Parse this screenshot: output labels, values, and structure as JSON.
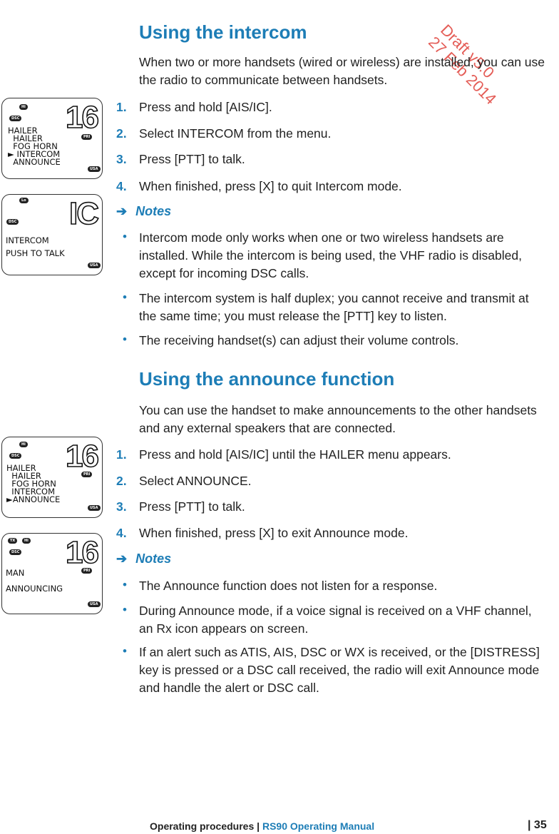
{
  "section1": {
    "title": "Using the intercom",
    "intro": "When two or more handsets (wired or wireless) are installed, you can use the radio to communicate between handsets.",
    "steps": [
      {
        "n": "1.",
        "text": "Press and hold [AIS/IC]."
      },
      {
        "n": "2.",
        "text": "Select INTERCOM from the menu."
      },
      {
        "n": "3.",
        "text": "Press [PTT] to talk."
      },
      {
        "n": "4.",
        "text": "When finished, press [X] to quit Intercom mode."
      }
    ],
    "notes_label": "Notes",
    "bullets": [
      "Intercom mode only works when one or two wireless handsets are installed. While the intercom is being used, the VHF radio is disabled, except for incoming DSC calls.",
      "The intercom system is half duplex; you cannot receive and transmit at the same time; you must release the [PTT] key to listen.",
      "The receiving handset(s) can adjust their volume controls."
    ]
  },
  "section2": {
    "title": "Using the announce function",
    "intro": "You can use the handset to make announcements to the other handsets and any external speakers that are connected.",
    "steps": [
      {
        "n": "1.",
        "text": "Press and hold [AIS/IC] until the HAILER menu appears."
      },
      {
        "n": "2.",
        "text": "Select ANNOUNCE."
      },
      {
        "n": "3.",
        "text": "Press [PTT] to talk."
      },
      {
        "n": "4.",
        "text": "When finished, press [X] to exit Announce mode."
      }
    ],
    "notes_label": "Notes",
    "bullets": [
      "The Announce function does not listen for a response.",
      "During Announce mode, if a voice signal is received on a VHF channel, an Rx icon appears on screen.",
      "If an alert such as ATIS, AIS, DSC or WX is received, or the [DISTRESS] key is pressed or a DSC call received, the radio will exit Announce mode and handle the alert or DSC call."
    ]
  },
  "lcd1": {
    "power": "Hi",
    "dsc": "DSC",
    "channel": "16",
    "pri": "PRI",
    "region": "USA",
    "lines": [
      "HAILER",
      "  HAILER",
      "  FOG HORN",
      "► INTERCOM",
      "  ANNOUNCE"
    ]
  },
  "lcd2": {
    "power": "Lo",
    "dsc": "DSC",
    "channel": "IC",
    "region": "USA",
    "lines": [
      "INTERCOM",
      "PUSH TO TALK"
    ]
  },
  "lcd3": {
    "power": "Hi",
    "dsc": "DSC",
    "channel": "16",
    "pri": "PRI",
    "region": "USA",
    "lines": [
      "HAILER",
      "  HAILER",
      "  FOG HORN",
      "  INTERCOM",
      "►ANNOUNCE"
    ]
  },
  "lcd4": {
    "tx": "TX",
    "power": "Hi",
    "dsc": "DSC",
    "channel": "16",
    "pri": "PRI",
    "region": "USA",
    "lines": [
      "MAN",
      "ANNOUNCING"
    ]
  },
  "footer": {
    "section": "Operating procedures |",
    "manual": "RS90 Operating Manual",
    "page": "| 35"
  },
  "watermark": {
    "line1": "Draft v5.0",
    "line2": "27 Feb 2014"
  },
  "colors": {
    "accent": "#1d7db6",
    "watermark": "#e0413a"
  }
}
